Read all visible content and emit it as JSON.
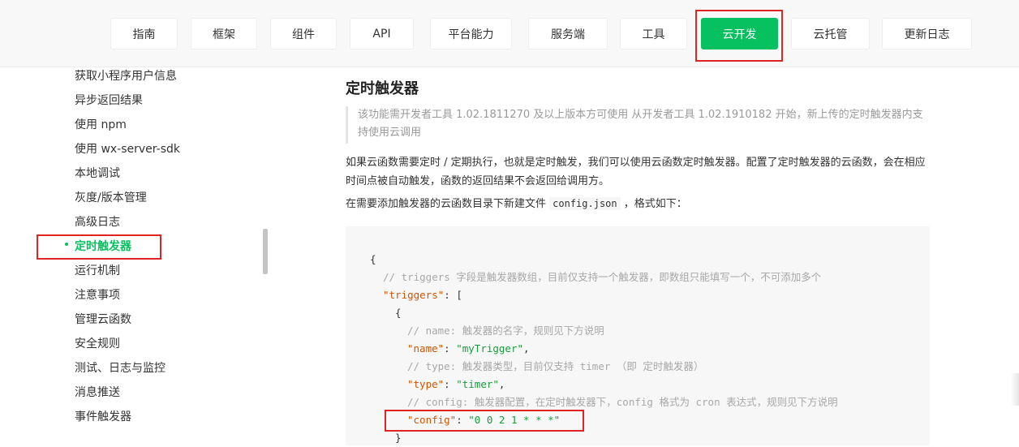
{
  "nav": {
    "items": [
      "指南",
      "框架",
      "组件",
      "API",
      "平台能力",
      "服务端",
      "工具",
      "云开发",
      "云托管",
      "更新日志"
    ],
    "active": "云开发"
  },
  "sidebar": {
    "items": [
      "获取小程序用户信息",
      "异步返回结果",
      "使用 npm",
      "使用 wx-server-sdk",
      "本地调试",
      "灰度/版本管理",
      "高级日志",
      "定时触发器",
      "运行机制",
      "注意事项",
      "管理云函数",
      "安全规则",
      "测试、日志与监控",
      "消息推送",
      "事件触发器"
    ],
    "active": "定时触发器"
  },
  "content": {
    "title": "定时触发器",
    "notice": "该功能需开发者工具 1.02.1811270 及以上版本方可使用 从开发者工具 1.02.1910182 开始，新上传的定时触发器内支持使用云调用",
    "para1": "如果云函数需要定时 / 定期执行，也就是定时触发，我们可以使用云函数定时触发器。配置了定时触发器的云函数，会在相应时间点被自动触发，函数的返回结果不会返回给调用方。",
    "para2_before": "在需要添加触发器的云函数目录下新建文件",
    "para2_code": "config.json",
    "para2_after": "，格式如下：",
    "code": {
      "open_brace": "{",
      "comment_triggers": "// triggers 字段是触发器数组，目前仅支持一个触发器，即数组只能填写一个，不可添加多个",
      "triggers_key": "\"triggers\"",
      "triggers_punc": ": [",
      "item_open": "{",
      "comment_name": "// name: 触发器的名字，规则见下方说明",
      "name_key": "\"name\"",
      "name_val": "\"myTrigger\"",
      "comment_type": "// type: 触发器类型，目前仅支持 timer （即 定时触发器）",
      "type_key": "\"type\"",
      "type_val": "\"timer\"",
      "comment_config": "// config: 触发器配置，在定时触发器下，config 格式为 cron 表达式，规则见下方说明",
      "config_key": "\"config\"",
      "config_val": "\"0 0 2 1 * * *\"",
      "item_close": "}"
    }
  },
  "colors": {
    "accent": "#07c160",
    "highlight": "#e02424"
  }
}
